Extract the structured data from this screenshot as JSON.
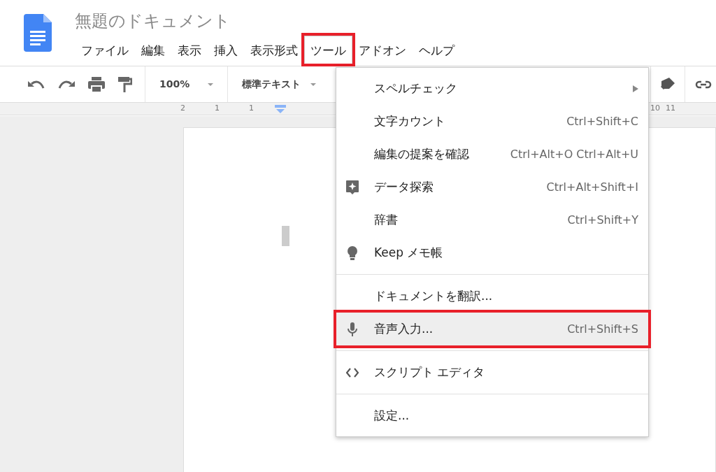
{
  "document": {
    "title": "無題のドキュメント"
  },
  "menubar": [
    {
      "label": "ファイル",
      "selected": false,
      "annotated": false
    },
    {
      "label": "編集",
      "selected": false,
      "annotated": false
    },
    {
      "label": "表示",
      "selected": false,
      "annotated": false
    },
    {
      "label": "挿入",
      "selected": false,
      "annotated": false
    },
    {
      "label": "表示形式",
      "selected": false,
      "annotated": false
    },
    {
      "label": "ツール",
      "selected": true,
      "annotated": true
    },
    {
      "label": "アドオン",
      "selected": false,
      "annotated": false
    },
    {
      "label": "ヘルプ",
      "selected": false,
      "annotated": false
    }
  ],
  "toolbar": {
    "zoom": "100%",
    "style": "標準テキスト"
  },
  "ruler": {
    "left_labels": [
      "2",
      "1",
      "1"
    ],
    "right_labels": [
      "10",
      "11"
    ]
  },
  "menu": [
    {
      "kind": "submenu",
      "label": "スペルチェック",
      "selected": false,
      "annotated": false
    },
    {
      "kind": "item",
      "label": "文字カウント",
      "shortcut": "Ctrl+Shift+C",
      "selected": false,
      "annotated": false
    },
    {
      "kind": "item",
      "label": "編集の提案を確認",
      "shortcut": "Ctrl+Alt+O Ctrl+Alt+U",
      "selected": false,
      "annotated": false
    },
    {
      "kind": "insight",
      "label": "データ探索",
      "shortcut": "Ctrl+Alt+Shift+I",
      "selected": false,
      "annotated": false
    },
    {
      "kind": "item",
      "label": "辞書",
      "shortcut": "Ctrl+Shift+Y",
      "selected": false,
      "annotated": false
    },
    {
      "kind": "note",
      "label": "Keep メモ帳",
      "selected": false,
      "annotated": false
    },
    {
      "kind": "separator"
    },
    {
      "kind": "item",
      "label": "ドキュメントを翻訳...",
      "selected": false,
      "annotated": false
    },
    {
      "kind": "voice",
      "label": "音声入力...",
      "shortcut": "Ctrl+Shift+S",
      "selected": true,
      "annotated": true
    },
    {
      "kind": "separator"
    },
    {
      "kind": "script",
      "label": "スクリプト エディタ",
      "selected": false,
      "annotated": false
    },
    {
      "kind": "separator"
    },
    {
      "kind": "item",
      "label": "設定...",
      "selected": false,
      "annotated": false
    }
  ]
}
